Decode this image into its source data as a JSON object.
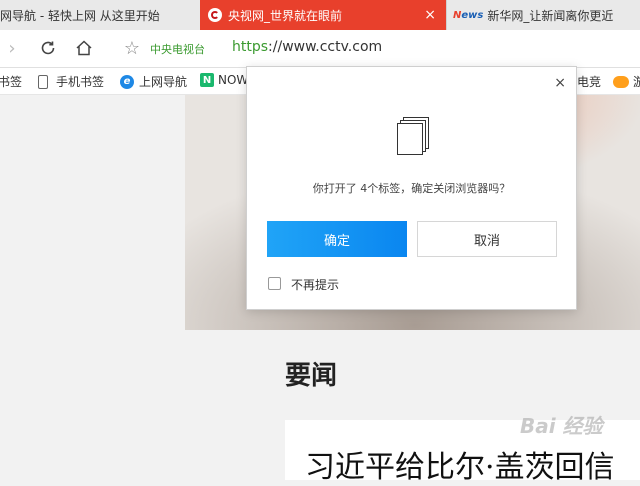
{
  "tabs": [
    {
      "title": "网导航 - 轻快上网 从这里开始"
    },
    {
      "title": "央视网_世界就在眼前",
      "close": "×"
    },
    {
      "title": "新华网_让新闻离你更近",
      "icon_text_a": "N",
      "icon_text_b": "ews"
    }
  ],
  "address": {
    "site_name": "中央电视台",
    "url_proto": "https",
    "url_rest": "://www.cctv.com"
  },
  "bookmarks": [
    {
      "label": "书签"
    },
    {
      "label": "手机书签"
    },
    {
      "label": "上网导航",
      "icon": "e"
    },
    {
      "label": "NOW",
      "icon": "N"
    },
    {
      "label": "电竞"
    },
    {
      "label": "游"
    }
  ],
  "page": {
    "section_title": "要闻",
    "headline": "习近平给比尔·盖茨回信",
    "watermark": "Bai 经验"
  },
  "dialog": {
    "close": "×",
    "message": "你打开了 4个标签，确定关闭浏览器吗？",
    "ok_label": "确定",
    "cancel_label": "取消",
    "checkbox_label": "不再提示"
  },
  "colors": {
    "active_tab": "#e8402c",
    "ok_button": "#0a86f0",
    "site_name": "#3a9a2f"
  }
}
